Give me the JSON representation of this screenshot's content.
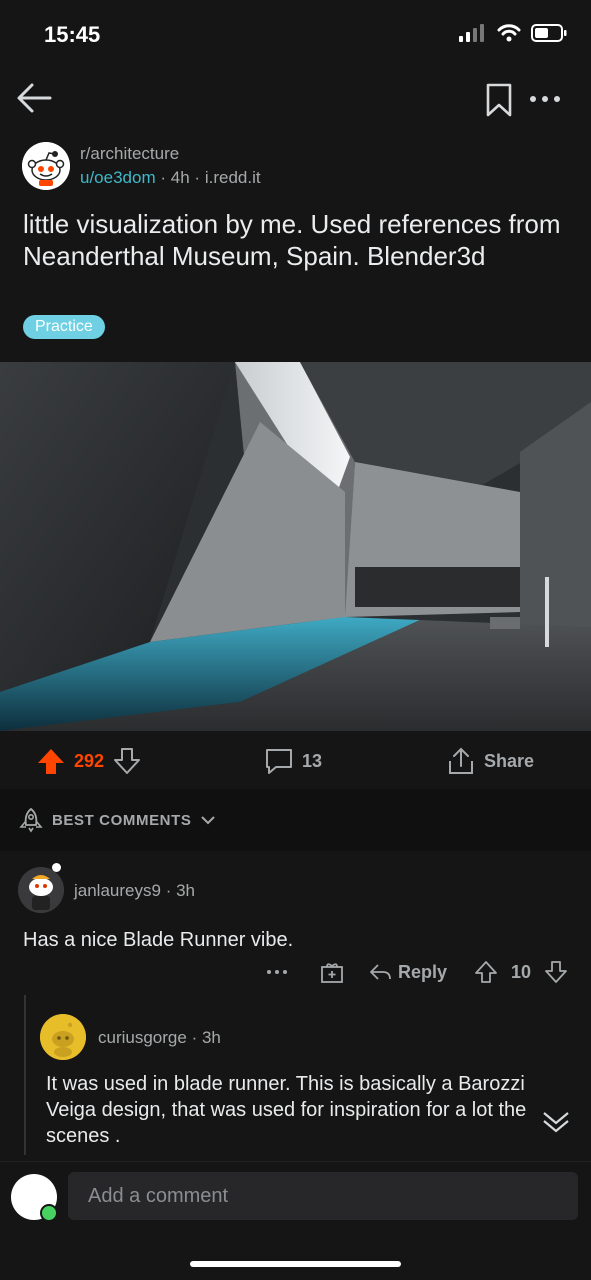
{
  "status": {
    "time": "15:45",
    "icons": [
      "signal-icon",
      "wifi-icon",
      "battery-icon"
    ]
  },
  "topbar": {
    "icons": [
      "back-arrow-icon",
      "bookmark-icon",
      "more-dots-icon"
    ]
  },
  "post": {
    "subreddit": "r/architecture",
    "author": "u/oe3dom",
    "age": "4h",
    "domain": "i.redd.it",
    "separator": "·",
    "title": "little visualization by me. Used references from Neanderthal Museum, Spain. Blender3d",
    "flair": "Practice",
    "flair_color": "#6fd0e3",
    "votes": "292",
    "comments": "13",
    "share_label": "Share",
    "upvote_color": "#ff4500"
  },
  "sort": {
    "label": "BEST COMMENTS"
  },
  "comments": [
    {
      "author": "janlaureys9",
      "age": "3h",
      "body": "Has a nice Blade Runner vibe.",
      "reply_label": "Reply",
      "votes": "10"
    },
    {
      "author": "curiusgorge",
      "age": "3h",
      "body": "It was used in blade runner. This is basically a Barozzi Veiga design, that was used for inspiration for a lot the scenes ."
    }
  ],
  "composer": {
    "placeholder": "Add a comment"
  },
  "colors": {
    "background": "#1a1a1b",
    "accent_link": "#3fb8c9",
    "online": "#46d160"
  }
}
